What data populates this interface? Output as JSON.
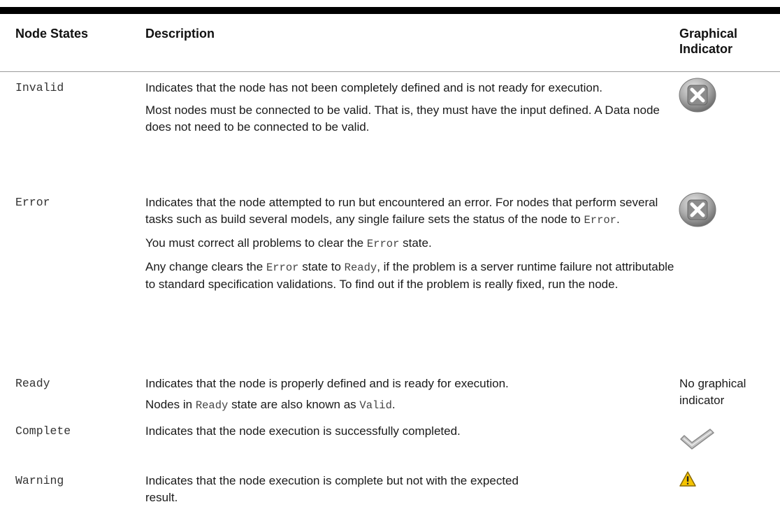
{
  "header": {
    "col1": "Node States",
    "col2": "Description",
    "col3_line1": "Graphical",
    "col3_line2": "Indicator"
  },
  "rows": [
    {
      "state": "Invalid",
      "p1": "Indicates that the node has not been completely defined and is not ready for execution.",
      "p2": "Most nodes must be connected to be valid. That is, they must have the input defined. A Data node does not need to be connected to be valid.",
      "indicator": "error-x-icon"
    },
    {
      "state": "Error",
      "p1_a": "Indicates that the node attempted to run but encountered an error. For nodes that perform several tasks such as build several models, any single failure sets the status of the node to ",
      "p1_code": "Error",
      "p1_b": ".",
      "p2_a": "You must correct all problems to clear the ",
      "p2_code": "Error",
      "p2_b": " state.",
      "p3_a": "Any change clears the ",
      "p3_code1": "Error",
      "p3_b": " state to ",
      "p3_code2": "Ready",
      "p3_c": ", if the problem is a server runtime failure not attributable to standard specification validations. To find out if the problem is really fixed, run the node.",
      "indicator": "error-x-icon"
    },
    {
      "state": "Ready",
      "p1": "Indicates that the node is properly defined and is ready for execution.",
      "p2_a": "Nodes in ",
      "p2_code1": "Ready",
      "p2_b": " state are also known as ",
      "p2_code2": "Valid",
      "p2_c": ".",
      "indicator_text_1": "No graphical",
      "indicator_text_2": "indicator"
    },
    {
      "state": "Complete",
      "p1": "Indicates that the node execution is successfully completed.",
      "indicator": "checkmark-icon"
    },
    {
      "state": "Warning",
      "p1": "Indicates that the node execution is complete but not with the expected result.",
      "indicator": "warning-triangle-icon"
    }
  ]
}
